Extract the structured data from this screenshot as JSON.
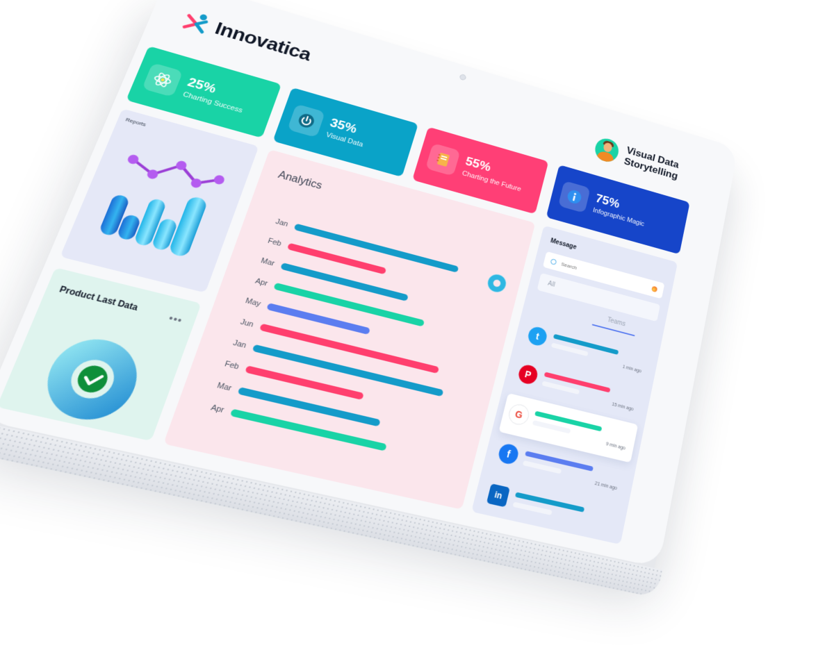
{
  "brand": {
    "name": "Innovatica"
  },
  "profile": {
    "name": "Visual Data Storytelling"
  },
  "stats": [
    {
      "percent": "25%",
      "label": "Charting Success",
      "icon": "atom-icon",
      "color": "#19d3a6"
    },
    {
      "percent": "35%",
      "label": "Visual Data",
      "icon": "power-icon",
      "color": "#0aa3c8"
    },
    {
      "percent": "55%",
      "label": "Charting the Future",
      "icon": "notebook-icon",
      "color": "#ff3f76"
    },
    {
      "percent": "75%",
      "label": "Infographic Magic",
      "icon": "info-icon",
      "color": "#1645c9"
    }
  ],
  "reports": {
    "title": "Reports"
  },
  "product": {
    "title": "Product Last Data",
    "more": "•••"
  },
  "analytics": {
    "title": "Analytics",
    "rows": [
      {
        "month": "Jan",
        "color": "#149bc9",
        "level": 0.82
      },
      {
        "month": "Feb",
        "color": "#ff3f6e",
        "level": 0.48
      },
      {
        "month": "Mar",
        "color": "#149bc9",
        "level": 0.62
      },
      {
        "month": "Apr",
        "color": "#19d3a6",
        "level": 0.73
      },
      {
        "month": "May",
        "color": "#5b7df0",
        "level": 0.49
      },
      {
        "month": "Jun",
        "color": "#ff3f6e",
        "level": 0.86
      },
      {
        "month": "Jan",
        "color": "#149bc9",
        "level": 0.91
      },
      {
        "month": "Feb",
        "color": "#ff3f6e",
        "level": 0.55
      },
      {
        "month": "Mar",
        "color": "#149bc9",
        "level": 0.66
      },
      {
        "month": "Apr",
        "color": "#19d3a6",
        "level": 0.72
      }
    ]
  },
  "message": {
    "title": "Message",
    "search_placeholder": "Search",
    "tab_all": "All",
    "tab_teams": "Teams",
    "items": [
      {
        "source": "twitter",
        "icon": "twitter-icon",
        "time": "1 min ago",
        "color": "#149bc9",
        "badge": "#1da1f2",
        "glyph": "t"
      },
      {
        "source": "pinterest",
        "icon": "pinterest-icon",
        "time": "15 min ago",
        "color": "#ff3f6e",
        "badge": "#e60023",
        "glyph": "P"
      },
      {
        "source": "google",
        "icon": "google-icon",
        "time": "9 min ago",
        "color": "#19d3a6",
        "badge": "#ffffff",
        "glyph": "G"
      },
      {
        "source": "facebook",
        "icon": "facebook-icon",
        "time": "21 min ago",
        "color": "#5b7df0",
        "badge": "#1877f2",
        "glyph": "f"
      },
      {
        "source": "linkedin",
        "icon": "linkedin-icon",
        "time": "",
        "color": "#149bc9",
        "badge": "#0a66c2",
        "glyph": "in"
      }
    ]
  }
}
